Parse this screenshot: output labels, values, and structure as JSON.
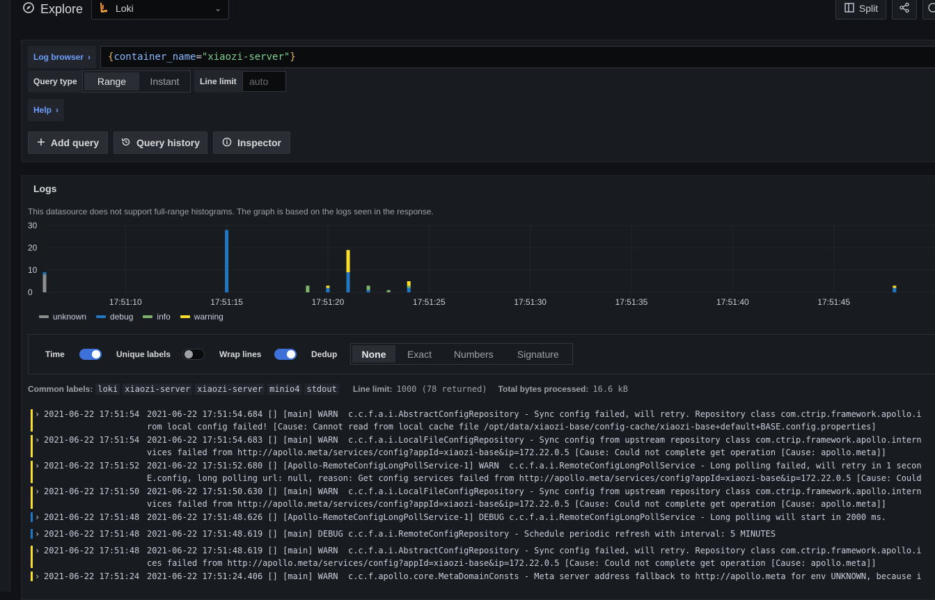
{
  "header": {
    "title": "Explore",
    "datasource": "Loki",
    "split_label": "Split"
  },
  "query": {
    "log_browser_label": "Log browser",
    "expression": {
      "brace_open": "{",
      "key": "container_name",
      "op": "=",
      "value": "\"xiaozi-server\"",
      "brace_close": "}"
    },
    "query_type_label": "Query type",
    "query_type_options": [
      "Range",
      "Instant"
    ],
    "query_type_selected": "Range",
    "line_limit_label": "Line limit",
    "line_limit_placeholder": "auto",
    "help_label": "Help",
    "add_query_label": "Add query",
    "query_history_label": "Query history",
    "inspector_label": "Inspector"
  },
  "logs": {
    "title": "Logs",
    "histogram_note": "This datasource does not support full-range histograms. The graph is based on the logs seen in the response.",
    "options": {
      "time_label": "Time",
      "time_on": true,
      "unique_labels_label": "Unique labels",
      "unique_labels_on": false,
      "wrap_lines_label": "Wrap lines",
      "wrap_lines_on": true,
      "dedup_label": "Dedup",
      "dedup_options": [
        "None",
        "Exact",
        "Numbers",
        "Signature"
      ],
      "dedup_selected": "None"
    },
    "common_labels_label": "Common labels:",
    "common_labels": [
      "loki",
      "xiaozi-server",
      "xiaozi-server",
      "minio4",
      "stdout"
    ],
    "line_limit_label": "Line limit:",
    "line_limit_value": "1000 (78 returned)",
    "total_bytes_label": "Total bytes processed:",
    "total_bytes_value": "16.6 kB",
    "level_colors": {
      "warning": "#fade2a",
      "debug": "#1f78c1",
      "info": "#7eb26d",
      "unknown": "#8e8e8e"
    },
    "rows": [
      {
        "level": "warning",
        "ts": "2021-06-22 17:51:54",
        "lines": [
          "2021-06-22 17:51:54.684 [] [main] WARN  c.c.f.a.i.AbstractConfigRepository - Sync config failed, will retry. Repository class com.ctrip.framework.apollo.i",
          "rom local config failed! [Cause: Cannot read from local cache file /opt/data/xiaozi-base/config-cache/xiaozi-base+default+BASE.config.properties]"
        ]
      },
      {
        "level": "warning",
        "ts": "2021-06-22 17:51:54",
        "lines": [
          "2021-06-22 17:51:54.683 [] [main] WARN  c.c.f.a.i.LocalFileConfigRepository - Sync config from upstream repository class com.ctrip.framework.apollo.intern",
          "vices failed from http://apollo.meta/services/config?appId=xiaozi-base&ip=172.22.0.5 [Cause: Could not complete get operation [Cause: apollo.meta]]"
        ]
      },
      {
        "level": "warning",
        "ts": "2021-06-22 17:51:52",
        "lines": [
          "2021-06-22 17:51:52.680 [] [Apollo-RemoteConfigLongPollService-1] WARN  c.c.f.a.i.RemoteConfigLongPollService - Long polling failed, will retry in 1 secon",
          "E.config, long polling url: null, reason: Get config services failed from http://apollo.meta/services/config?appId=xiaozi-base&ip=172.22.0.5 [Cause: Could"
        ]
      },
      {
        "level": "warning",
        "ts": "2021-06-22 17:51:50",
        "lines": [
          "2021-06-22 17:51:50.630 [] [main] WARN  c.c.f.a.i.LocalFileConfigRepository - Sync config from upstream repository class com.ctrip.framework.apollo.intern",
          "vices failed from http://apollo.meta/services/config?appId=xiaozi-base&ip=172.22.0.5 [Cause: Could not complete get operation [Cause: apollo.meta]]"
        ]
      },
      {
        "level": "debug",
        "ts": "2021-06-22 17:51:48",
        "lines": [
          "2021-06-22 17:51:48.626 [] [Apollo-RemoteConfigLongPollService-1] DEBUG c.c.f.a.i.RemoteConfigLongPollService - Long polling will start in 2000 ms."
        ]
      },
      {
        "level": "debug",
        "ts": "2021-06-22 17:51:48",
        "lines": [
          "2021-06-22 17:51:48.619 [] [main] DEBUG c.c.f.a.i.RemoteConfigRepository - Schedule periodic refresh with interval: 5 MINUTES"
        ]
      },
      {
        "level": "warning",
        "ts": "2021-06-22 17:51:48",
        "lines": [
          "2021-06-22 17:51:48.619 [] [main] WARN  c.c.f.a.i.AbstractConfigRepository - Sync config failed, will retry. Repository class com.ctrip.framework.apollo.i",
          "ces failed from http://apollo.meta/services/config?appId=xiaozi-base&ip=172.22.0.5 [Cause: Could not complete get operation [Cause: apollo.meta]]"
        ]
      },
      {
        "level": "warning",
        "ts": "2021-06-22 17:51:24",
        "lines": [
          "2021-06-22 17:51:24.406 [] [main] WARN  c.c.f.apollo.core.MetaDomainConsts - Meta server address fallback to http://apollo.meta for env UNKNOWN, because i"
        ]
      }
    ]
  },
  "chart_data": {
    "type": "bar",
    "stacked": true,
    "x_ticks": [
      "17:51:10",
      "17:51:15",
      "17:51:20",
      "17:51:25",
      "17:51:30",
      "17:51:35",
      "17:51:40",
      "17:51:45"
    ],
    "y_ticks": [
      0,
      10,
      20,
      30
    ],
    "ylim": [
      0,
      30
    ],
    "xlim": [
      "17:51:06",
      "17:51:50"
    ],
    "legend_position": "bottom-left",
    "grid": true,
    "series": [
      {
        "name": "unknown",
        "color": "#8e8e8e"
      },
      {
        "name": "debug",
        "color": "#1f78c1"
      },
      {
        "name": "info",
        "color": "#7eb26d"
      },
      {
        "name": "warning",
        "color": "#fade2a"
      }
    ],
    "bars": [
      {
        "t": "17:51:06",
        "unknown": 8,
        "debug": 1,
        "info": 0,
        "warning": 0
      },
      {
        "t": "17:51:15",
        "unknown": 0,
        "debug": 28,
        "info": 0,
        "warning": 0
      },
      {
        "t": "17:51:19",
        "unknown": 0,
        "debug": 0,
        "info": 3,
        "warning": 0
      },
      {
        "t": "17:51:20",
        "unknown": 0,
        "debug": 2,
        "info": 0,
        "warning": 1
      },
      {
        "t": "17:51:21",
        "unknown": 0,
        "debug": 9,
        "info": 0,
        "warning": 10
      },
      {
        "t": "17:51:22",
        "unknown": 0,
        "debug": 1,
        "info": 2,
        "warning": 0
      },
      {
        "t": "17:51:23",
        "unknown": 0,
        "debug": 0,
        "info": 1,
        "warning": 0
      },
      {
        "t": "17:51:24",
        "unknown": 0,
        "debug": 2,
        "info": 1,
        "warning": 2
      },
      {
        "t": "17:51:48",
        "unknown": 0,
        "debug": 2,
        "info": 0,
        "warning": 1
      }
    ]
  }
}
